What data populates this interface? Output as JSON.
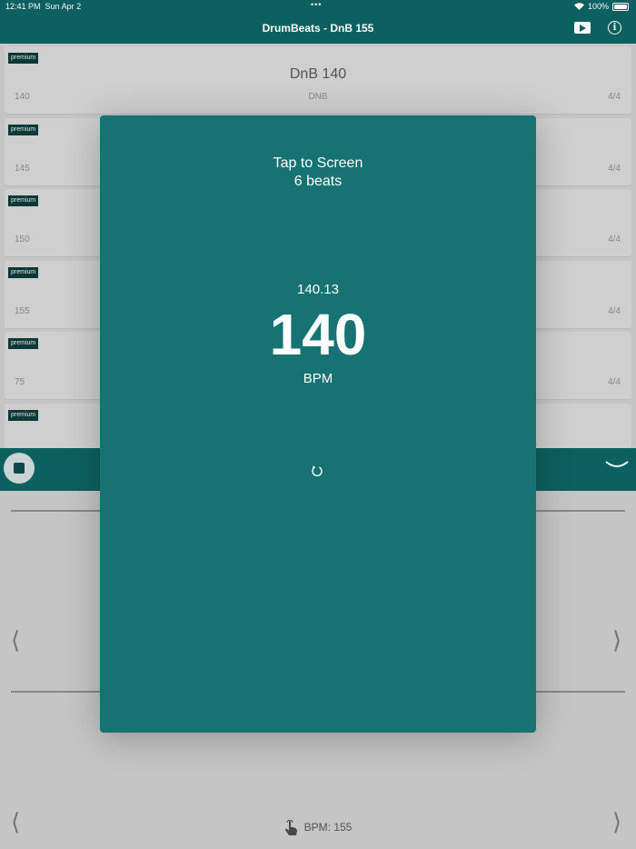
{
  "status": {
    "time": "12:41 PM",
    "date": "Sun Apr 2",
    "battery": "100%"
  },
  "nav": {
    "title": "DrumBeats - DnB 155"
  },
  "list": [
    {
      "badge": "premium",
      "name": "DnB 140",
      "bpm": "140",
      "genre": "DNB",
      "signature": "4/4"
    },
    {
      "badge": "premium",
      "name": "",
      "bpm": "145",
      "genre": "",
      "signature": "4/4"
    },
    {
      "badge": "premium",
      "name": "",
      "bpm": "150",
      "genre": "",
      "signature": "4/4"
    },
    {
      "badge": "premium",
      "name": "",
      "bpm": "155",
      "genre": "",
      "signature": "4/4"
    },
    {
      "badge": "premium",
      "name": "",
      "bpm": "75",
      "genre": "",
      "signature": "4/4"
    },
    {
      "badge": "premium",
      "name": "",
      "bpm": "",
      "genre": "",
      "signature": ""
    }
  ],
  "bottom": {
    "bpm_label": "BPM: 155"
  },
  "modal": {
    "tap_line1": "Tap to Screen",
    "tap_line2": "6 beats",
    "exact_bpm": "140.13",
    "rounded_bpm": "140",
    "unit": "BPM"
  },
  "colors": {
    "primary": "#0e6262",
    "modal": "#177373",
    "background": "#c9c9c9"
  }
}
